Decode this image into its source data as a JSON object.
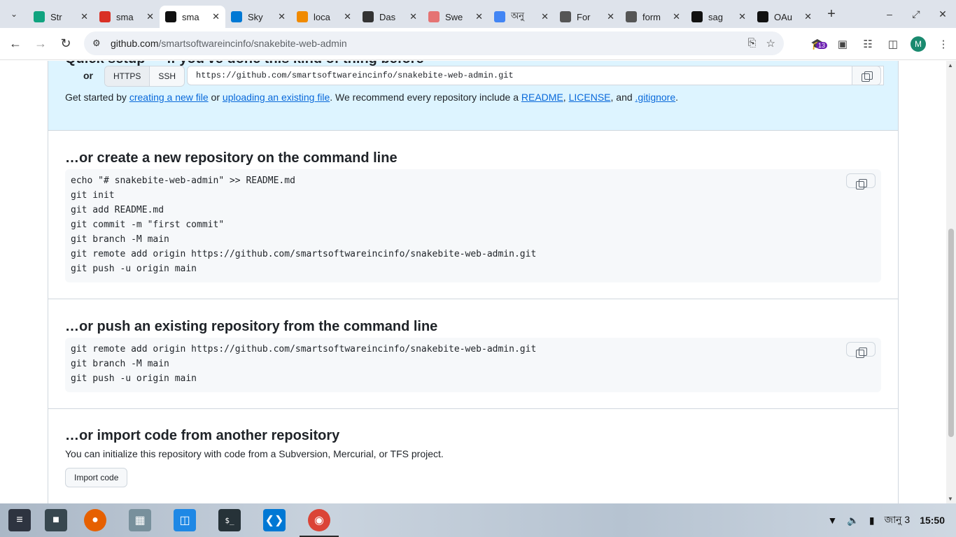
{
  "browser": {
    "tabs": [
      {
        "label": "Str",
        "icon": "chatgpt-icon",
        "color": "#10a37f"
      },
      {
        "label": "sma",
        "icon": "gmail-icon",
        "color": "#d93025"
      },
      {
        "label": "sma",
        "icon": "github-icon",
        "color": "#111111",
        "active": true
      },
      {
        "label": "Sky",
        "icon": "skype-icon",
        "color": "#0078d4"
      },
      {
        "label": "loca",
        "icon": "phpmyadmin-icon",
        "color": "#f08a00"
      },
      {
        "label": "Das",
        "icon": "dashboard-icon",
        "color": "#333333"
      },
      {
        "label": "Swe",
        "icon": "sweetalert-icon",
        "color": "#e57373"
      },
      {
        "label": "অনু",
        "icon": "google-icon",
        "color": "#4285f4"
      },
      {
        "label": "For",
        "icon": "globe-icon",
        "color": "#555555"
      },
      {
        "label": "form",
        "icon": "globe-icon",
        "color": "#555555"
      },
      {
        "label": "sag",
        "icon": "github-icon",
        "color": "#111111"
      },
      {
        "label": "OAu",
        "icon": "github-icon",
        "color": "#111111"
      }
    ],
    "url_host": "github.com",
    "url_path": "/smartsoftwareincinfo/snakebite-web-admin",
    "extension_badge": "13",
    "profile_initial": "M"
  },
  "quick_setup": {
    "title": "Quick setup — if you've done this kind of thing before",
    "or_label": "or",
    "protocol_https": "HTTPS",
    "protocol_ssh": "SSH",
    "clone_url": "https://github.com/smartsoftwareincinfo/snakebite-web-admin.git",
    "getstarted_prefix": "Get started by ",
    "link_new_file": "creating a new file",
    "or_word": " or ",
    "link_upload": "uploading an existing file",
    "recommend": ". We recommend every repository include a ",
    "link_readme": "README",
    "comma": ", ",
    "link_license": "LICENSE",
    "and_word": ", and ",
    "link_gitignore": ".gitignore",
    "period": "."
  },
  "create_new": {
    "title": "…or create a new repository on the command line",
    "lines": [
      "echo \"# snakebite-web-admin\" >> README.md",
      "git init",
      "git add README.md",
      "git commit -m \"first commit\"",
      "git branch -M main",
      "git remote add origin https://github.com/smartsoftwareincinfo/snakebite-web-admin.git",
      "git push -u origin main"
    ]
  },
  "push_existing": {
    "title": "…or push an existing repository from the command line",
    "lines": [
      "git remote add origin https://github.com/smartsoftwareincinfo/snakebite-web-admin.git",
      "git branch -M main",
      "git push -u origin main"
    ]
  },
  "import_code": {
    "title": "…or import code from another repository",
    "description": "You can initialize this repository with code from a Subversion, Mercurial, or TFS project.",
    "button": "Import code"
  },
  "taskbar": {
    "date": "জানু 3",
    "time": "15:50"
  }
}
